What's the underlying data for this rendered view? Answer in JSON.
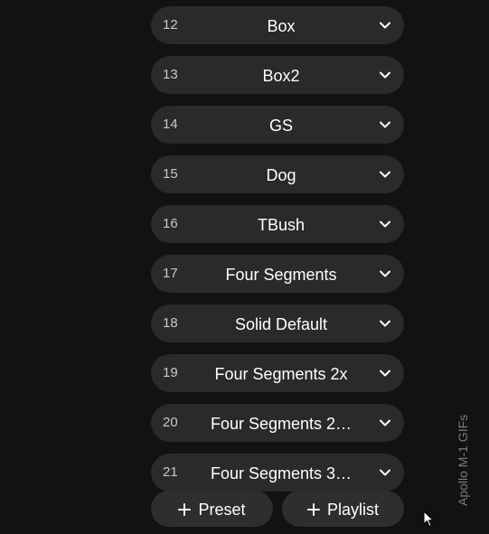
{
  "items": [
    {
      "num": "12",
      "label": "Box"
    },
    {
      "num": "13",
      "label": "Box2"
    },
    {
      "num": "14",
      "label": "GS"
    },
    {
      "num": "15",
      "label": "Dog"
    },
    {
      "num": "16",
      "label": "TBush"
    },
    {
      "num": "17",
      "label": "Four Segments"
    },
    {
      "num": "18",
      "label": "Solid Default"
    },
    {
      "num": "19",
      "label": "Four Segments 2x"
    },
    {
      "num": "20",
      "label": "Four Segments 2…"
    },
    {
      "num": "21",
      "label": "Four Segments 3…"
    }
  ],
  "footer": {
    "preset_label": "Preset",
    "playlist_label": "Playlist"
  },
  "side_label": "Apollo M-1 GIFs",
  "icons": {
    "row_action": "chevron-down-icon",
    "add": "plus-icon",
    "pointer": "mouse-cursor-icon"
  },
  "colors": {
    "background": "#121212",
    "row": "#2a2a2a",
    "button": "#2e2e2e",
    "text": "#ffffff",
    "muted": "#7a7a7a"
  }
}
